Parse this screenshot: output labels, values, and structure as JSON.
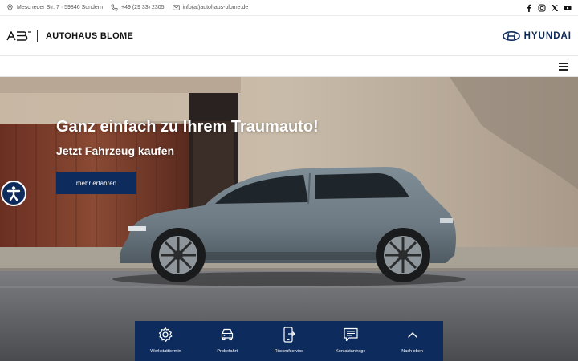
{
  "topbar": {
    "address": "Mescheder Str. 7 · 59846 Sundern",
    "phone": "+49 (29 33) 2305",
    "email": "info(at)autohaus-blome.de"
  },
  "header": {
    "dealer_name": "AUTOHAUS BLOME",
    "brand_name": "HYUNDAI"
  },
  "hero": {
    "title": "Ganz einfach zu Ihrem Traumauto!",
    "subtitle": "Jetzt Fahrzeug kaufen",
    "cta_label": "mehr erfahren"
  },
  "quick_actions": [
    {
      "icon": "gear-icon",
      "label": "Werkstatttermin"
    },
    {
      "icon": "car-icon",
      "label": "Probefahrt"
    },
    {
      "icon": "phone-forward-icon",
      "label": "Rückrufservice"
    },
    {
      "icon": "chat-icon",
      "label": "Kontaktanfrage"
    },
    {
      "icon": "chevron-up-icon",
      "label": "Nach oben"
    }
  ],
  "colors": {
    "brand_navy": "#0d2b5c",
    "hyundai_blue": "#0b2a5b"
  }
}
